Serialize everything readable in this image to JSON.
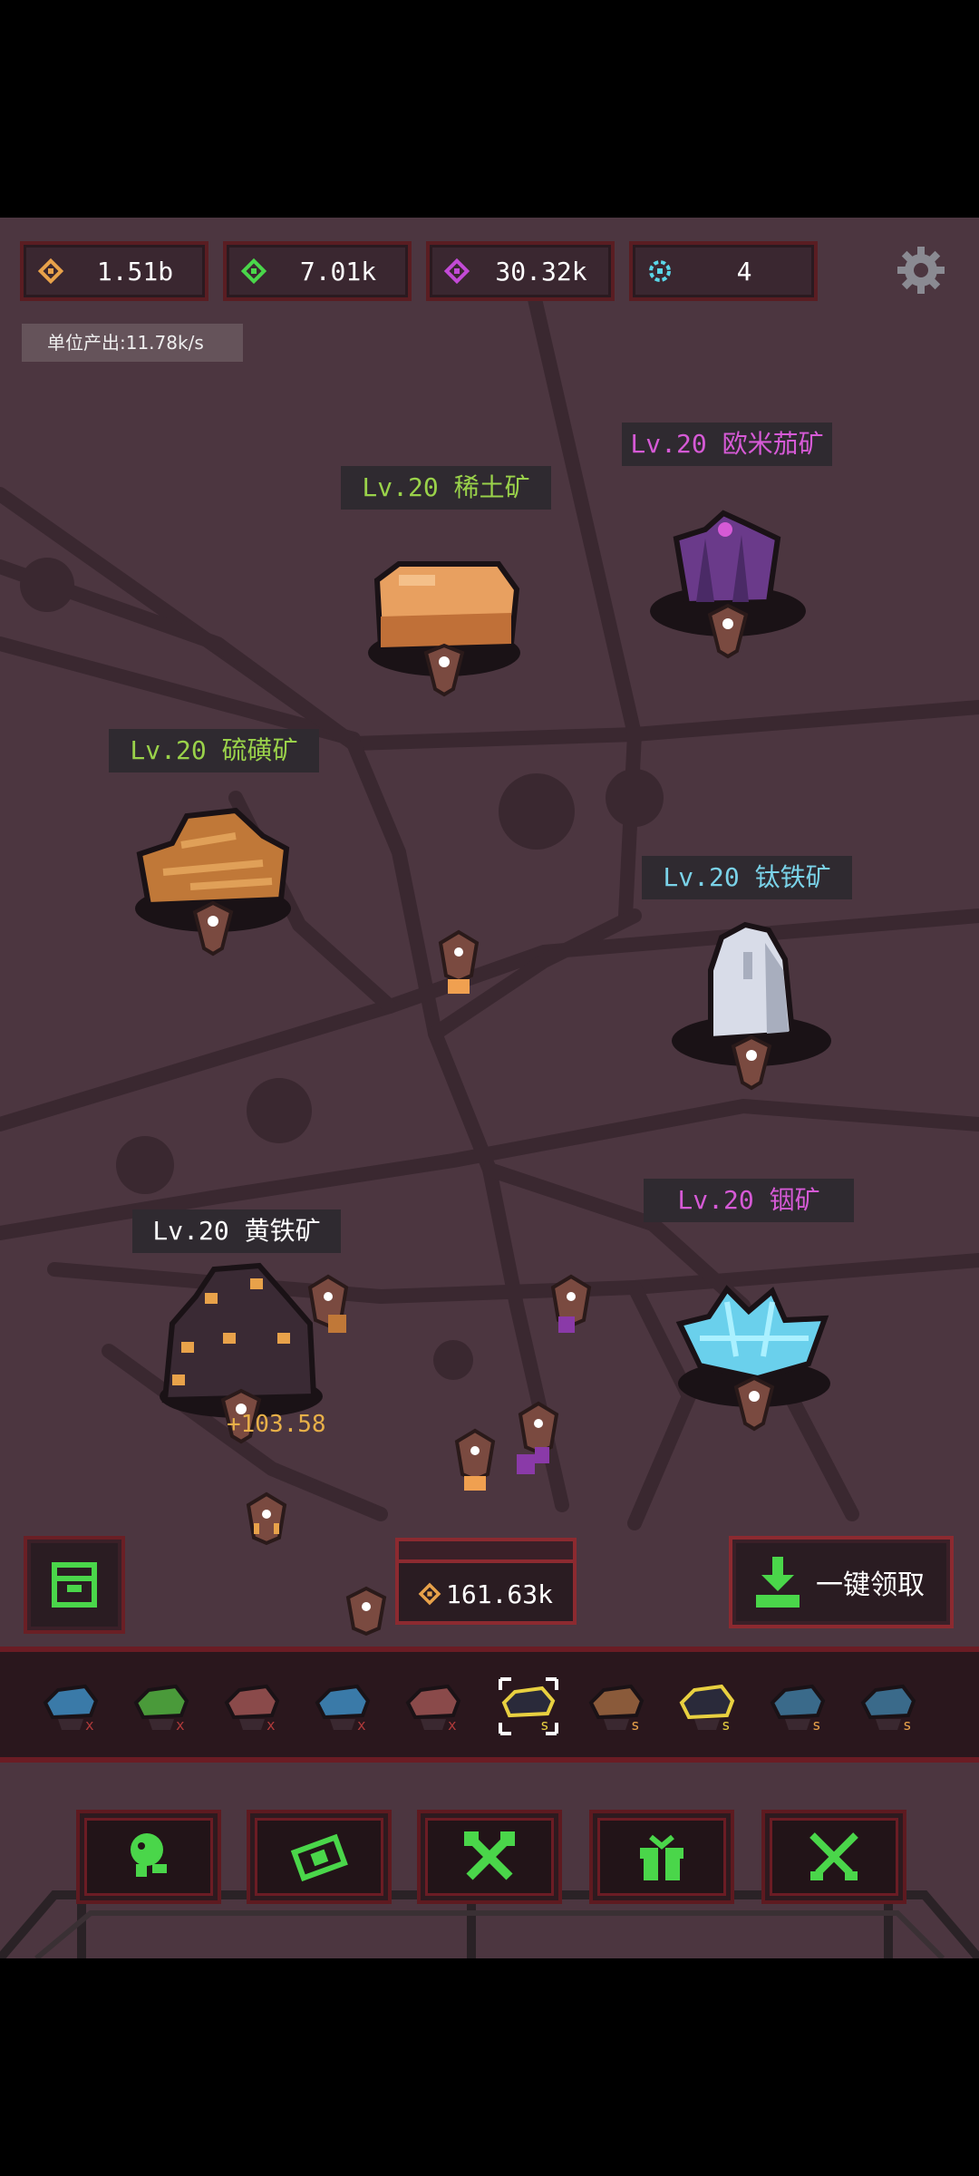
{
  "resources": [
    {
      "icon": "gold-ore-icon",
      "value": "1.51b",
      "color": "#e8a24a"
    },
    {
      "icon": "green-gem-icon",
      "value": "7.01k",
      "color": "#4ad64a"
    },
    {
      "icon": "purple-gem-icon",
      "value": "30.32k",
      "color": "#c34ad6"
    },
    {
      "icon": "blue-gem-icon",
      "value": "4",
      "color": "#5ad6e8"
    }
  ],
  "unit_output": "单位产出:11.78k/s",
  "mines": [
    {
      "label": "Lv.20 稀土矿",
      "color": "#9ad24a",
      "type": "rare-earth"
    },
    {
      "label": "Lv.20 欧米茄矿",
      "color": "#d65ad6",
      "type": "omega"
    },
    {
      "label": "Lv.20 硫磺矿",
      "color": "#9ad24a",
      "type": "sulfur"
    },
    {
      "label": "Lv.20 钛铁矿",
      "color": "#7ad2e8",
      "type": "ilmenite"
    },
    {
      "label": "Lv.20 黄铁矿",
      "color": "#ffffff",
      "type": "pyrite"
    },
    {
      "label": "Lv.20 铟矿",
      "color": "#d65ad6",
      "type": "indium"
    }
  ],
  "floating_gain": "+103.58",
  "storage": {
    "amount": "161.63k",
    "icon": "gold-ore-icon"
  },
  "collect_all": {
    "label": "一键领取",
    "icon": "download-tray-icon"
  },
  "miners": [
    {
      "icon": "miner-blue-icon",
      "color": "#3a7aa8"
    },
    {
      "icon": "miner-green-icon",
      "color": "#4a9a3a"
    },
    {
      "icon": "miner-brown-icon",
      "color": "#8a4a4a"
    },
    {
      "icon": "miner-blue-icon",
      "color": "#3a7aa8"
    },
    {
      "icon": "miner-brown-icon",
      "color": "#8a4a4a"
    },
    {
      "icon": "miner-dark-gold-icon",
      "color": "#2a2a3a"
    },
    {
      "icon": "miner-brown-gold-icon",
      "color": "#8a5a3a"
    },
    {
      "icon": "miner-dark-gold-icon",
      "color": "#2a2a3a"
    },
    {
      "icon": "miner-blue-icon",
      "color": "#3a6a8a"
    },
    {
      "icon": "miner-blue-icon",
      "color": "#3a6a8a"
    }
  ],
  "nav": [
    {
      "icon": "worm-icon"
    },
    {
      "icon": "cash-icon"
    },
    {
      "icon": "tools-icon"
    },
    {
      "icon": "gift-icon"
    },
    {
      "icon": "swords-icon"
    }
  ]
}
